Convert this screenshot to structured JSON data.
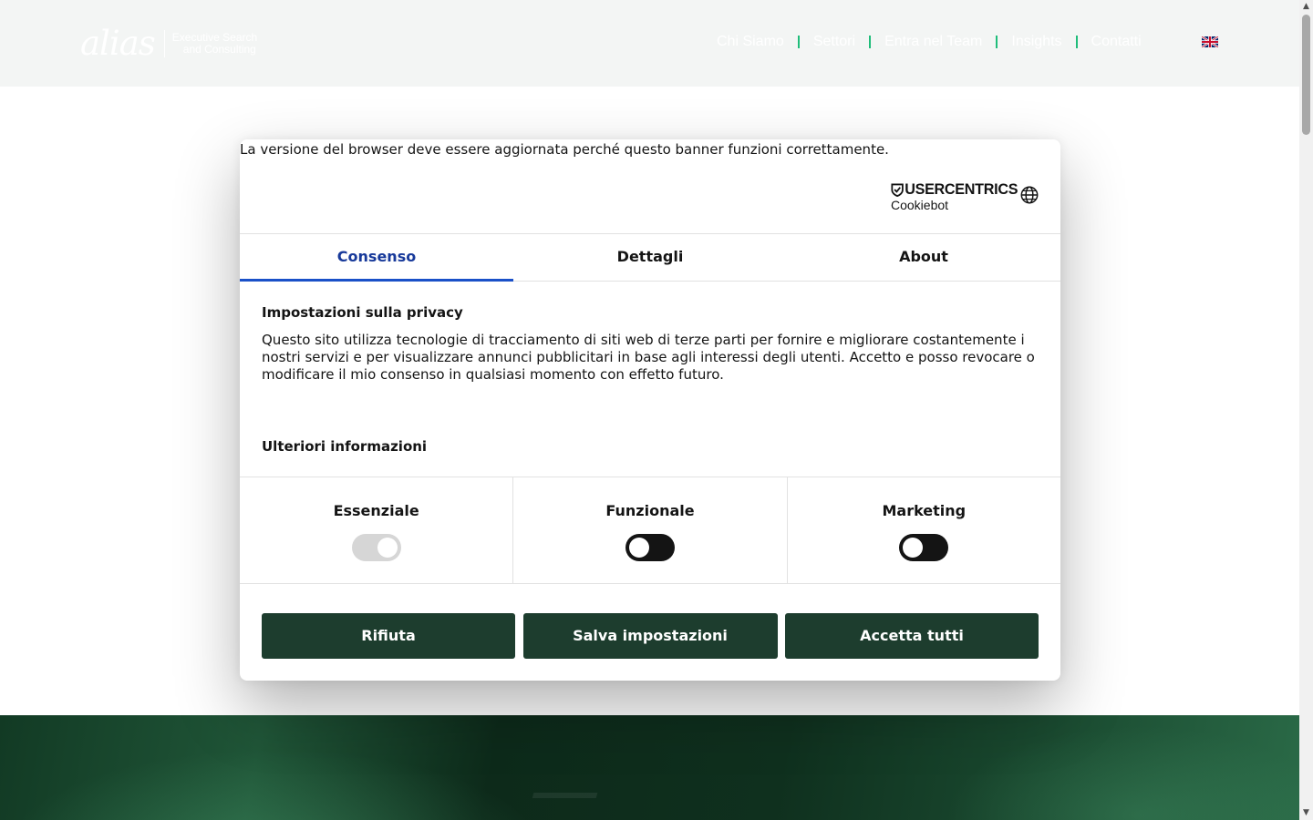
{
  "header": {
    "logo_word": "alias",
    "logo_tagline_1": "Executive Search",
    "logo_tagline_2": "and Consulting",
    "nav": [
      {
        "label": "Chi Siamo"
      },
      {
        "label": "Settori"
      },
      {
        "label": "Entra nel Team"
      },
      {
        "label": "Insights"
      },
      {
        "label": "Contatti"
      }
    ],
    "language_flag": "uk-flag-icon",
    "nav_separator_color": "#1fbd7a"
  },
  "cookie_banner": {
    "browser_warning": "La versione del browser deve essere aggiornata perché questo banner funzioni correttamente.",
    "brand_name": "USERCENTRICS",
    "brand_product": "Cookiebot",
    "tabs": [
      {
        "label": "Consenso",
        "active": true
      },
      {
        "label": "Dettagli",
        "active": false
      },
      {
        "label": "About",
        "active": false
      }
    ],
    "privacy_title": "Impostazioni sulla privacy",
    "privacy_text": "Questo sito utilizza tecnologie di tracciamento di siti web di terze parti per fornire e migliorare costantemente i nostri servizi e per visualizzare annunci pubblicitari in base agli interessi degli utenti. Accetto e posso revocare o modificare il mio consenso in qualsiasi momento con effetto futuro.",
    "more_info_title": "Ulteriori informazioni",
    "categories": [
      {
        "label": "Essenziale",
        "enabled": true,
        "locked": true
      },
      {
        "label": "Funzionale",
        "enabled": false,
        "locked": false
      },
      {
        "label": "Marketing",
        "enabled": false,
        "locked": false
      }
    ],
    "buttons": {
      "reject": "Rifiuta",
      "save": "Salva impostazioni",
      "accept_all": "Accetta tutti"
    },
    "colors": {
      "active_tab": "#17399a",
      "button_bg": "#1d3d2e",
      "toggle_off": "#141414"
    }
  }
}
